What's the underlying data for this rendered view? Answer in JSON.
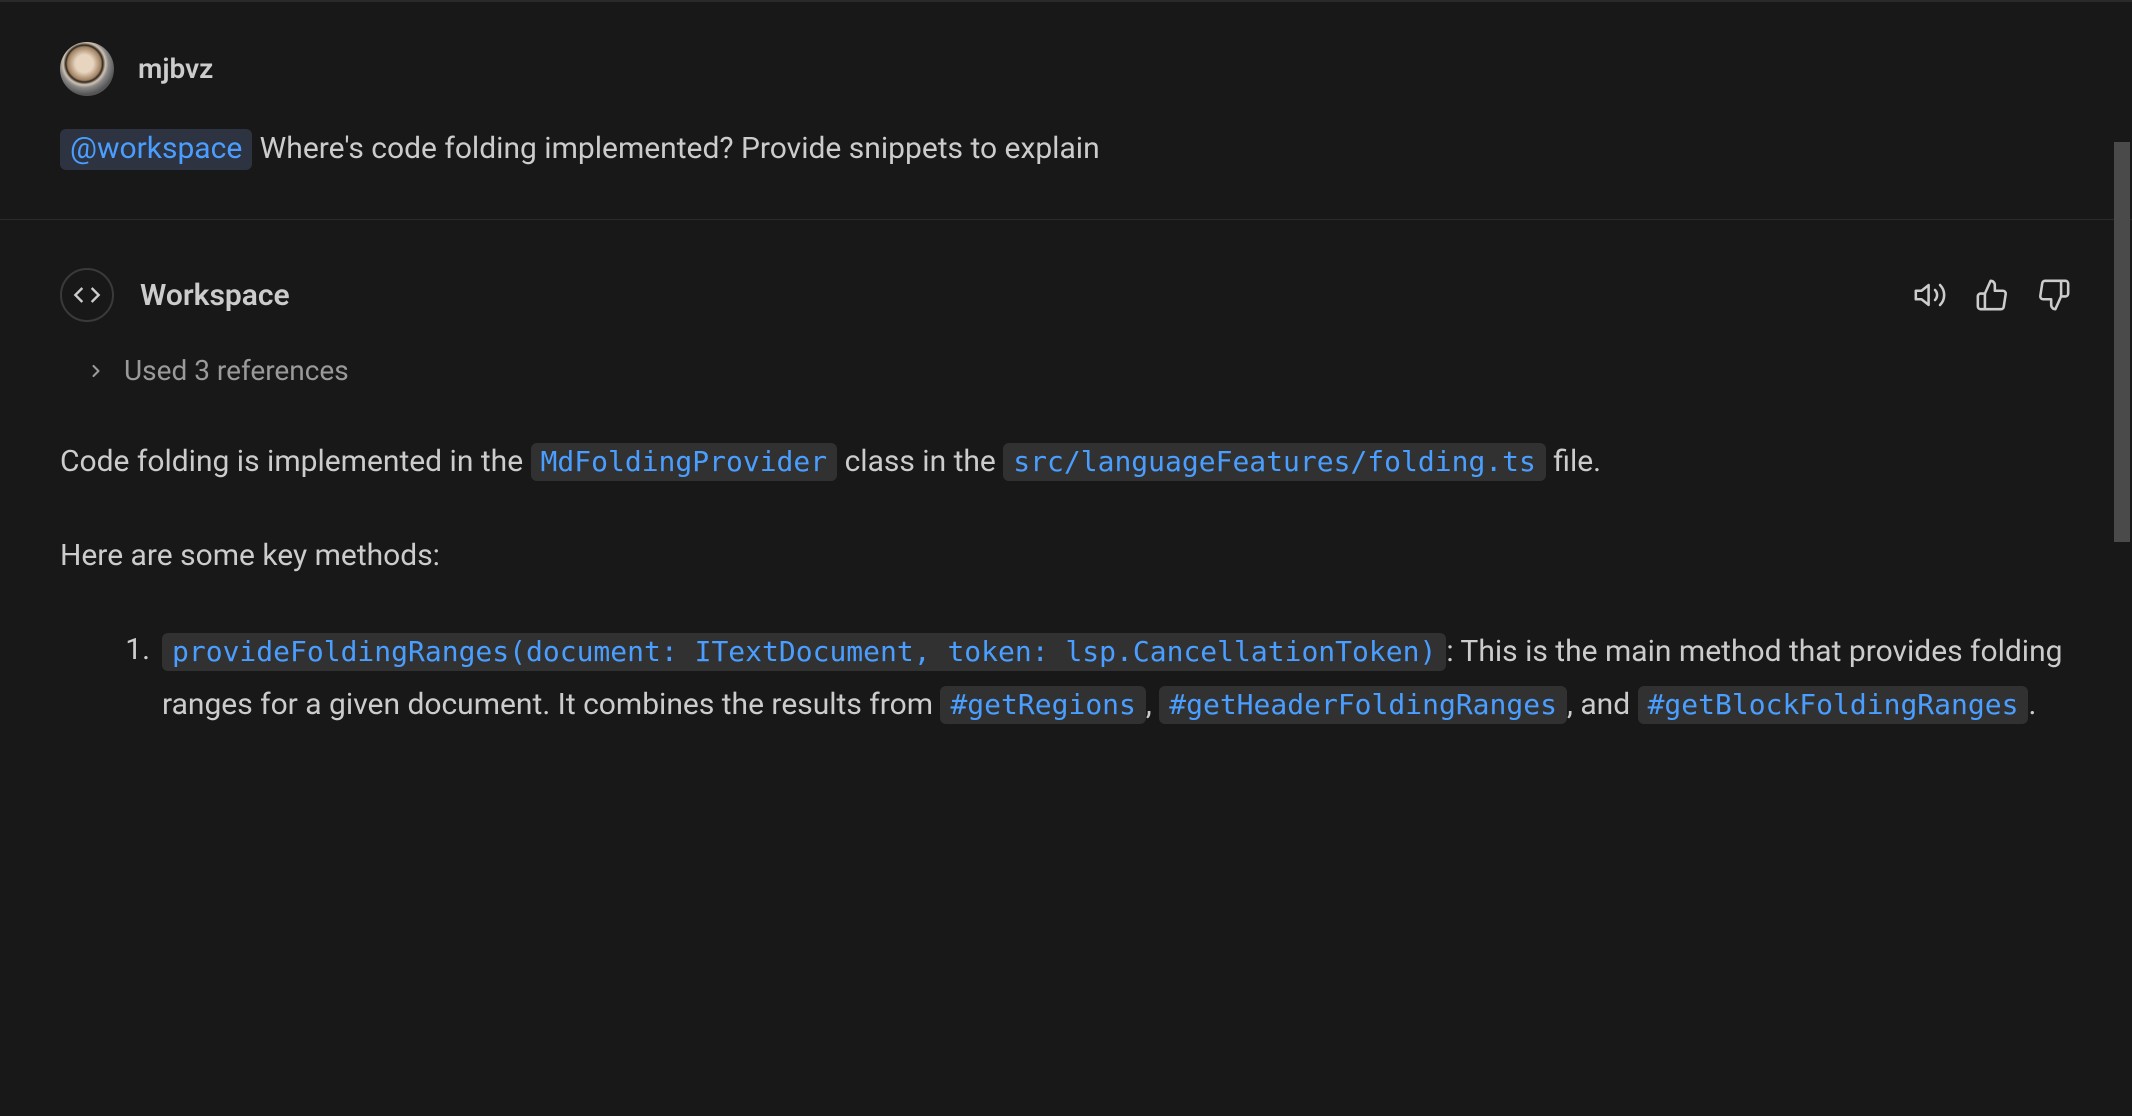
{
  "user": {
    "name": "mjbvz",
    "mention": "@workspace",
    "question": " Where's code folding implemented? Provide snippets to explain"
  },
  "assistant": {
    "title": "Workspace",
    "references_text": "Used 3 references",
    "intro_prefix": "Code folding is implemented in the ",
    "code_class": "MdFoldingProvider",
    "intro_mid": " class in the ",
    "code_path": "src/languageFeatures/folding.ts",
    "intro_suffix": " file.",
    "methods_heading": "Here are some key methods:",
    "item1": {
      "num": "1.",
      "signature": "provideFoldingRanges(document: ITextDocument, token: lsp.CancellationToken)",
      "desc_prefix": ": This is the main method that provides folding ranges for a given document. It combines the results from ",
      "m1": "#getRegions",
      "sep1": ", ",
      "m2": "#getHeaderFoldingRanges",
      "sep2": ", and ",
      "m3": "#getBlockFoldingRanges",
      "suffix": "."
    }
  }
}
